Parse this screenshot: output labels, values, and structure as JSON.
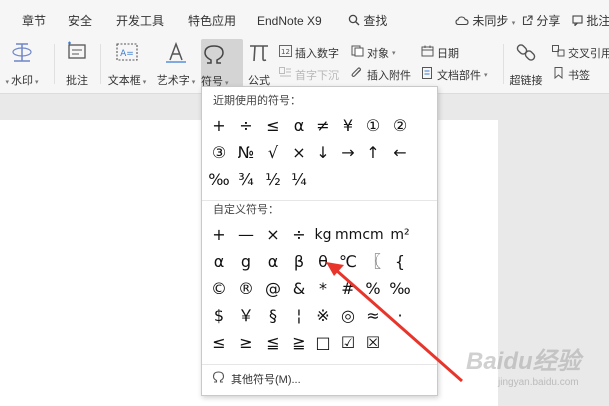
{
  "tabs": [
    {
      "label": "章节"
    },
    {
      "label": "安全"
    },
    {
      "label": "开发工具"
    },
    {
      "label": "特色应用"
    },
    {
      "label": "EndNote X9"
    },
    {
      "label": "查找"
    },
    {
      "label": "未同步"
    },
    {
      "label": "分享"
    },
    {
      "label": "批注"
    }
  ],
  "ribbon": {
    "watermark": "水印",
    "comment": "批注",
    "textbox": "文本框",
    "wordart": "艺术字",
    "symbol": "符号",
    "formula": "公式",
    "insert_number": "插入数字",
    "object": "对象",
    "date": "日期",
    "first_drop": "首字下沉",
    "insert_attachment": "插入附件",
    "doc_part": "文档部件",
    "hyperlink": "超链接",
    "cross_ref": "交叉引用",
    "bookmark": "书签"
  },
  "dropdown": {
    "recent_title": "近期使用的符号：",
    "recent_rows": [
      [
        "+",
        "÷",
        "≤",
        "α",
        "≠",
        "¥",
        "①",
        "②"
      ],
      [
        "③",
        "№",
        "√",
        "×",
        "↓",
        "→",
        "↑",
        "←"
      ],
      [
        "‰",
        "¾",
        "½",
        "¼"
      ]
    ],
    "custom_title": "自定义符号：",
    "custom_rows": [
      [
        "+",
        "—",
        "×",
        "÷",
        "kg",
        "mm",
        "cm",
        "m²"
      ],
      [
        "α",
        "g",
        "α",
        "β",
        "θ",
        "℃",
        "〖",
        "{"
      ],
      [
        "©",
        "®",
        "@",
        "&",
        "*",
        "#",
        "%",
        "‰"
      ],
      [
        "$",
        "￥",
        "§",
        "¦",
        "※",
        "◎",
        "≈",
        "·"
      ],
      [
        "≤",
        "≥",
        "≦",
        "≧",
        "□",
        "☑",
        "☒"
      ]
    ],
    "more_label": "其他符号(M)..."
  },
  "watermark_text": "Baidu经验",
  "watermark_sub": "jingyan.baidu.com",
  "colors": {
    "annotation_arrow": "#e8352b",
    "ribbon_bg": "#f6f6f6",
    "selected_button_bg": "#d4d4d4"
  }
}
